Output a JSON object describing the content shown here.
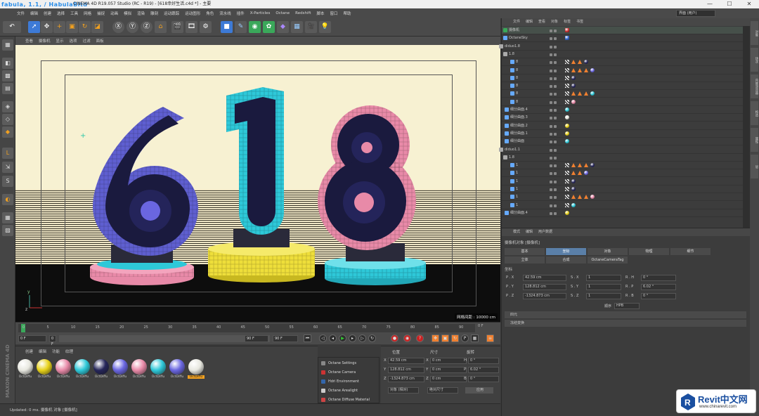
{
  "titlebar": {
    "brand": "fabula, 1.1, / HabulaBitd",
    "title": "CINEMA 4D R19.057 Studio (RC - R19) - [618幸好生活.c4d *] - 主要",
    "buttons": [
      "—",
      "☐",
      "✕"
    ]
  },
  "menubar": {
    "items": [
      "文件",
      "编辑",
      "创建",
      "选择",
      "工具",
      "网格",
      "捕捉",
      "动画",
      "模拟",
      "渲染",
      "雕刻",
      "运动跟踪",
      "运动图形",
      "角色",
      "流水线",
      "插件",
      "X-Particles",
      "Octane",
      "Redshift",
      "脚本",
      "窗口",
      "帮助"
    ],
    "layout_value": "界面 (用户)"
  },
  "viewport": {
    "menu": [
      "查看",
      "摄像机",
      "显示",
      "选项",
      "过滤",
      "面板"
    ],
    "grid_info": "网格间距 : 10000 cm",
    "colors": {
      "bg": "#f7f1d2",
      "blue": "#3b3a8c",
      "cyan": "#35c8d8",
      "pink": "#e88aa8",
      "yellow": "#eede3a",
      "dark": "#1a1a3a"
    }
  },
  "timeline": {
    "ticks": [
      "0",
      "5",
      "10",
      "15",
      "20",
      "25",
      "30",
      "35",
      "40",
      "45",
      "50",
      "55",
      "60",
      "65",
      "70",
      "75",
      "80",
      "85",
      "90"
    ],
    "end_label": "0 F",
    "start_field": "0 F",
    "cur_field": "0 F",
    "end_field": "90 F",
    "max_field": "90 F"
  },
  "materials": {
    "menu": [
      "创建",
      "编辑",
      "功能",
      "纹理"
    ],
    "items": [
      {
        "label": "OctDiffu",
        "color": "#e8e8e0"
      },
      {
        "label": "OctDiffu",
        "color": "#e8d21a"
      },
      {
        "label": "OctDiffu",
        "color": "#e88aa8"
      },
      {
        "label": "OctDiffu",
        "color": "#2ec8d8"
      },
      {
        "label": "OctDiffu",
        "color": "#26265a"
      },
      {
        "label": "OctDiffu",
        "color": "#6a66e0"
      },
      {
        "label": "OctDiffu",
        "color": "#e88aa8"
      },
      {
        "label": "OctDiffu",
        "color": "#2ec8d8"
      },
      {
        "label": "OctDiffu",
        "color": "#6a66e0"
      },
      {
        "label": "OctDiffu",
        "color": "#e8e8e0"
      }
    ]
  },
  "octane_menu": {
    "items": [
      {
        "label": "Octane Settings",
        "color": "#888"
      },
      {
        "label": "Octane Camera",
        "color": "#c33"
      },
      {
        "label": "Hdri Environment",
        "color": "#36a"
      },
      {
        "label": "Octane Arealight",
        "color": "#ccc"
      },
      {
        "label": "Octane Diffuse Material",
        "color": "#c44"
      }
    ]
  },
  "coords": {
    "headers": [
      "位置",
      "尺寸",
      "旋转"
    ],
    "rows": [
      {
        "a": "X",
        "pos": "42.59 cm",
        "b": "X",
        "size": "0 cm",
        "c": "H",
        "rot": "0 °"
      },
      {
        "a": "Y",
        "pos": "128.812 cm",
        "b": "Y",
        "size": "0 cm",
        "c": "P",
        "rot": "6.02 °"
      },
      {
        "a": "Z",
        "pos": "-1324.873 cm",
        "b": "Z",
        "size": "0 cm",
        "c": "B",
        "rot": "0 °"
      }
    ],
    "mode": "对象 (相对)",
    "size_mode": "绝对尺寸",
    "apply": "应用"
  },
  "status": {
    "text": "Updated: 0 ms.  摄像机 对象 [摄像机]"
  },
  "objects": {
    "menu": [
      "文件",
      "编辑",
      "查看",
      "对象",
      "标签",
      "书签"
    ],
    "rows": [
      {
        "name": "摄像机",
        "indent": 10,
        "tags": [
          "cam"
        ]
      },
      {
        "name": "OctaneSky",
        "indent": 10,
        "tags": [
          "sky"
        ]
      },
      {
        "name": "diduo1.8",
        "indent": 4,
        "tags": []
      },
      {
        "name": "1.8",
        "indent": 10,
        "tags": []
      },
      {
        "name": "8",
        "indent": 20,
        "tags": [
          "chk",
          "tri",
          "tri",
          "sph:#26265a"
        ]
      },
      {
        "name": "8",
        "indent": 20,
        "tags": [
          "chk",
          "tri",
          "tri",
          "tri",
          "sph:#6a66e0"
        ]
      },
      {
        "name": "8",
        "indent": 20,
        "tags": [
          "chk",
          "sph:#26265a"
        ]
      },
      {
        "name": "8",
        "indent": 20,
        "tags": [
          "chk",
          "sph:#26265a"
        ]
      },
      {
        "name": "8",
        "indent": 20,
        "tags": [
          "chk",
          "tri",
          "tri",
          "tri",
          "sph:#2ec8d8"
        ]
      },
      {
        "name": "8",
        "indent": 20,
        "tags": [
          "chk",
          "sph:#e88aa8"
        ]
      },
      {
        "name": "细分曲面.4",
        "indent": 12,
        "tags": [
          "sph:#2ec8d8"
        ]
      },
      {
        "name": "细分曲面.3",
        "indent": 12,
        "tags": [
          "sph:#e8e8e0"
        ]
      },
      {
        "name": "细分曲面.2",
        "indent": 12,
        "tags": [
          "sph:#e8d21a"
        ]
      },
      {
        "name": "细分曲面.1",
        "indent": 12,
        "tags": [
          "sph:#e8d21a"
        ]
      },
      {
        "name": "细分曲面",
        "indent": 12,
        "tags": [
          "sph:#2ec8d8"
        ]
      },
      {
        "name": "diduo1.1",
        "indent": 4,
        "tags": []
      },
      {
        "name": "1.8",
        "indent": 10,
        "tags": []
      },
      {
        "name": "1",
        "indent": 20,
        "tags": [
          "chk",
          "tri",
          "tri",
          "tri",
          "sph:#26265a"
        ]
      },
      {
        "name": "1",
        "indent": 20,
        "tags": [
          "chk",
          "tri",
          "tri",
          "sph:#6a66e0"
        ]
      },
      {
        "name": "1",
        "indent": 20,
        "tags": [
          "chk",
          "sph:#26265a"
        ]
      },
      {
        "name": "1",
        "indent": 20,
        "tags": [
          "chk",
          "sph:#26265a"
        ]
      },
      {
        "name": "1",
        "indent": 20,
        "tags": [
          "chk",
          "tri",
          "tri",
          "tri",
          "sph:#e88aa8"
        ]
      },
      {
        "name": "1",
        "indent": 20,
        "tags": [
          "chk",
          "sph:#2ec8d8"
        ]
      },
      {
        "name": "细分曲面.4",
        "indent": 12,
        "tags": [
          "sph:#e8d21a"
        ]
      }
    ]
  },
  "attributes": {
    "menu": [
      "模式",
      "编辑",
      "用户数据"
    ],
    "object_title": "摄像机对象 [摄像机]",
    "tabs_row1": [
      "基本",
      "坐标",
      "对象",
      "物理",
      "细节"
    ],
    "tabs_row2": [
      "立体",
      "合成",
      "OctaneCameraTag"
    ],
    "active_tab": "坐标",
    "section": "坐标",
    "rows": [
      {
        "p": "P . X",
        "pv": "42.59 cm",
        "s": "S . X",
        "sv": "1",
        "r": "R . H",
        "rv": "0 °"
      },
      {
        "p": "P . Y",
        "pv": "128.812 cm",
        "s": "S . Y",
        "sv": "1",
        "r": "R . P",
        "rv": "6.02 °"
      },
      {
        "p": "P . Z",
        "pv": "-1324.873 cm",
        "s": "S . Z",
        "sv": "1",
        "r": "R . B",
        "rv": "0 °"
      }
    ],
    "order_label": "顺序",
    "order_value": "HPB",
    "sections": [
      "四元",
      "冻结变换"
    ]
  },
  "sidetabs": [
    "对象",
    "场次",
    "内容浏览器",
    "构造",
    "属性",
    "层"
  ],
  "watermark": {
    "main": "Revit中文网",
    "sub": "www.chinarevit.com"
  }
}
